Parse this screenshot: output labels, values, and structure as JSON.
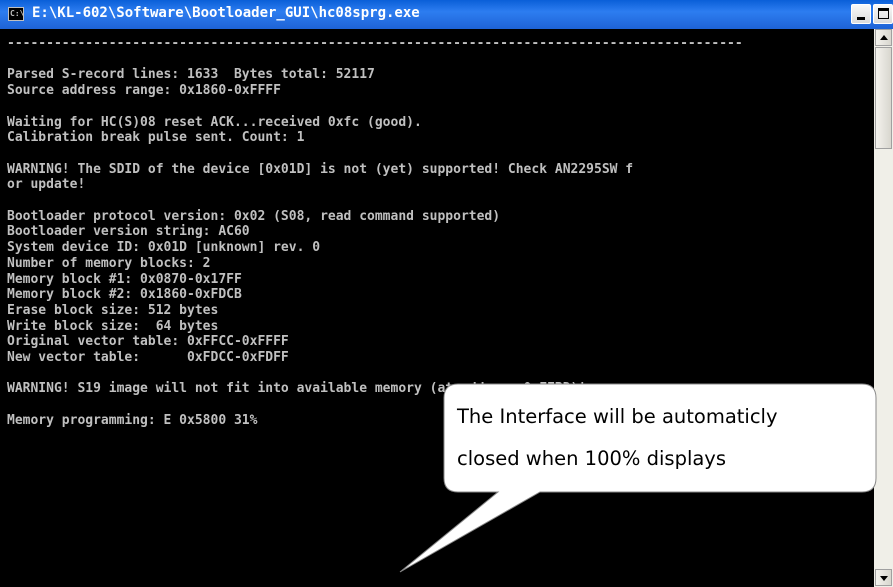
{
  "window": {
    "title": "E:\\KL-602\\Software\\Bootloader_GUI\\hc08sprg.exe",
    "icon": "cmd-icon",
    "icon_label": "C:\\",
    "controls": [
      "minimize",
      "maximize",
      "close"
    ]
  },
  "console": {
    "lines": [
      "----------------------------------------------------------------------------------------------",
      "",
      "Parsed S-record lines: 1633  Bytes total: 52117",
      "Source address range: 0x1860-0xFFFF",
      "",
      "Waiting for HC(S)08 reset ACK...received 0xfc (good).",
      "Calibration break pulse sent. Count: 1",
      "",
      "WARNING! The SDID of the device [0x01D] is not (yet) supported! Check AN2295SW f",
      "or update!",
      "",
      "Bootloader protocol version: 0x02 (S08, read command supported)",
      "Bootloader version string: AC60",
      "System device ID: 0x01D [unknown] rev. 0",
      "Number of memory blocks: 2",
      "Memory block #1: 0x0870-0x17FF",
      "Memory block #2: 0x1860-0xFDCB",
      "Erase block size: 512 bytes",
      "Write block size:  64 bytes",
      "Original vector table: 0xFFCC-0xFFFF",
      "New vector table:      0xFDCC-0xFDFF",
      "",
      "WARNING! S19 image will not fit into available memory (at address 0xFFBD)!",
      "",
      "Memory programming: E 0x5800 31%"
    ]
  },
  "callout": {
    "lines": [
      "The Interface will be automaticly",
      "closed when 100% displays"
    ]
  },
  "colors": {
    "console_bg": "#000000",
    "console_fg": "#c0c0c0",
    "titlebar": "#1e63d6"
  }
}
